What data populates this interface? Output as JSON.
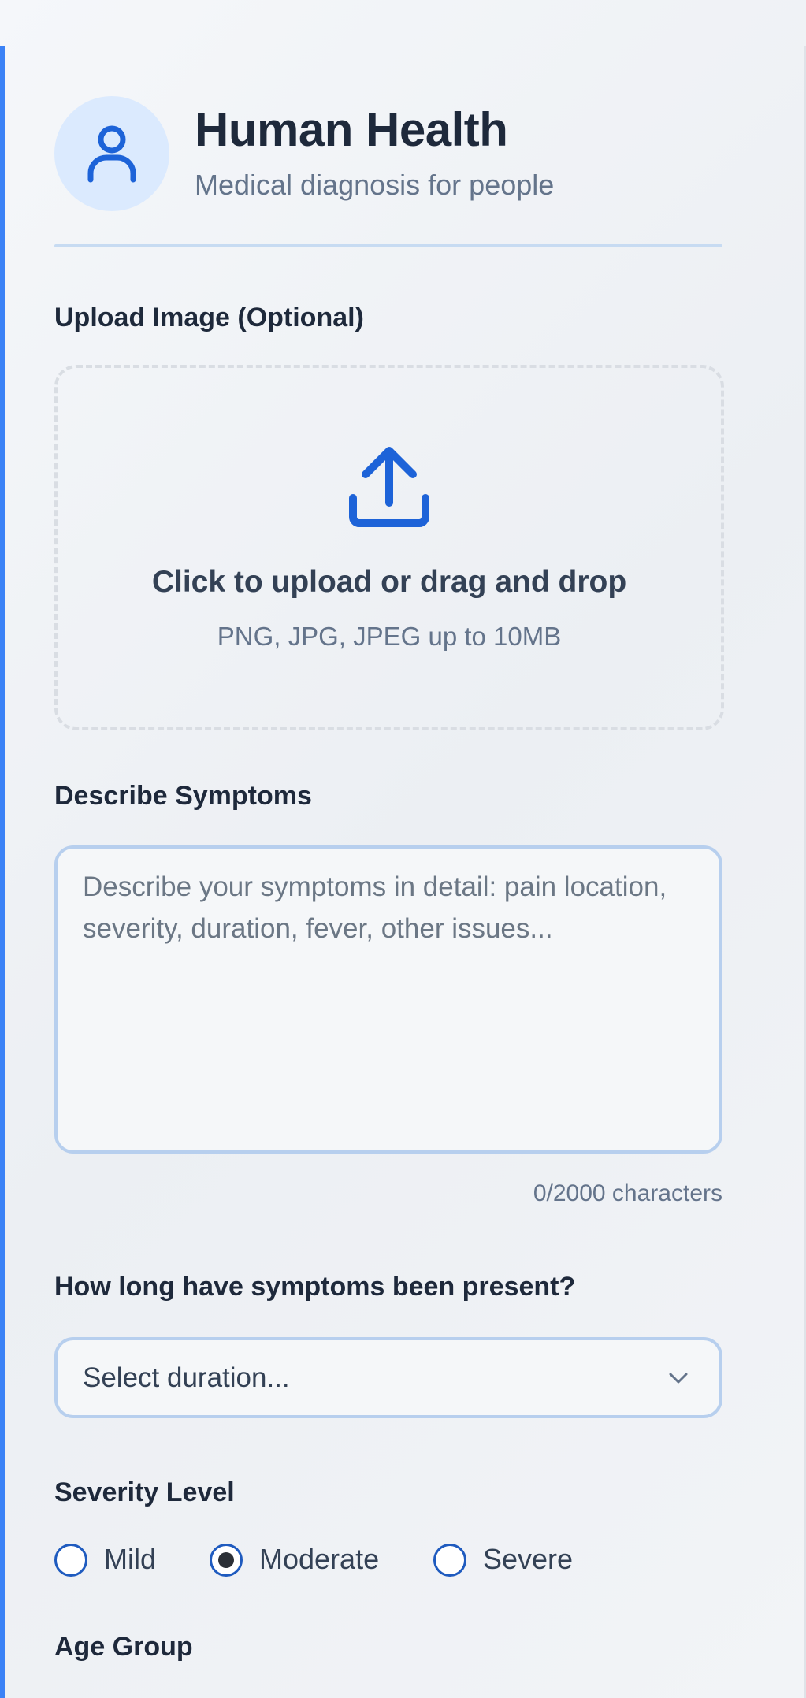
{
  "header": {
    "title": "Human Health",
    "subtitle": "Medical diagnosis for people",
    "avatar_icon": "person-icon"
  },
  "upload": {
    "label": "Upload Image (Optional)",
    "icon": "upload-icon",
    "title": "Click to upload or drag and drop",
    "hint": "PNG, JPG, JPEG up to 10MB"
  },
  "symptoms": {
    "label": "Describe Symptoms",
    "value": "",
    "placeholder": "Describe your symptoms in detail: pain location, severity, duration, fever, other issues...",
    "char_count": "0/2000 characters"
  },
  "duration": {
    "label": "How long have symptoms been present?",
    "selected": "Select duration...",
    "icon": "chevron-down-icon"
  },
  "severity": {
    "label": "Severity Level",
    "options": [
      {
        "label": "Mild",
        "checked": false
      },
      {
        "label": "Moderate",
        "checked": true
      },
      {
        "label": "Severe",
        "checked": false
      }
    ]
  },
  "age": {
    "label": "Age Group"
  },
  "colors": {
    "accent": "#3b82f6",
    "icon_blue": "#1d63d8",
    "avatar_bg": "#dbeafe",
    "input_border": "#b7cfee"
  }
}
